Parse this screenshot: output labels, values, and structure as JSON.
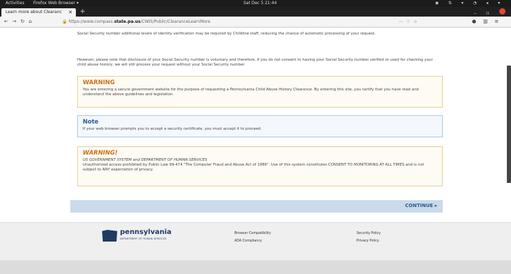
{
  "system": {
    "activities": "Activities",
    "app_name": "Firefox Web Browser ▾",
    "clock": "Sat Dec 5 21:44"
  },
  "browser": {
    "tab_title": "Learn more about Clearanc",
    "url_prefix": "https://www.compass.",
    "url_domain": "state.pa.us",
    "url_path": "/CWIS/Public/ClearanceLearnMore"
  },
  "page": {
    "top_paragraph": "Social Security number additional levels of identity verification may be required by Childline staff, reducing the chance of automatic processing of your request.",
    "second_paragraph": "However, please note that disclosure of your Social Security number is voluntary and therefore, if you do not consent to having your Social Security number verified or used for checking your child abuse history, we will still process your request without your Social Security number.",
    "warning": {
      "title": "WARNING",
      "text": "You are entering a secure government website for the purpose of requesting a Pennsylvania Child Abuse History Clearance. By entering this site, you certify that you have read and understand the above guidelines and legislation."
    },
    "note": {
      "title": "Note",
      "text": "If your web browser prompts you to accept a security certificate, you must accept it to proceed."
    },
    "warning2": {
      "title": "WARNING!",
      "subtitle": "US GOVERNMENT SYSTEM and DEPARTMENT OF HUMAN SERVICES",
      "text": "Unauthorized access prohibited by Public Law 99-474 \"The Computer Fraud and Abuse Act of 1986\". Use of this system constitutes CONSENT TO MONITORING AT ALL TIMES and is not subject to ANY expectation of privacy."
    },
    "continue_label": "CONTINUE ▸"
  },
  "footer": {
    "logo_text": "pennsylvania",
    "logo_sub": "DEPARTMENT OF HUMAN SERVICES",
    "links": [
      "Browser Compatibility",
      "ADA Compliancy",
      "Security Policy",
      "Privacy Policy"
    ]
  }
}
